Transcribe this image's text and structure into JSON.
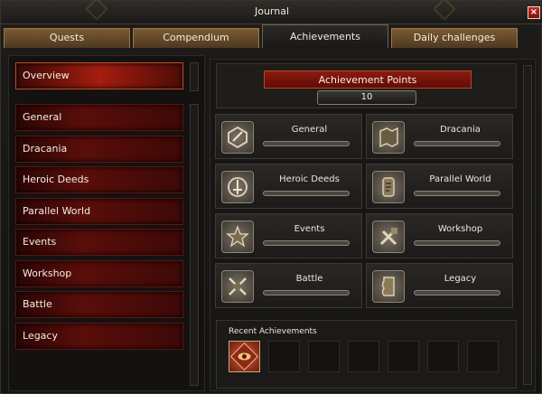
{
  "window": {
    "title": "Journal",
    "close_label": "×"
  },
  "tabs": [
    {
      "label": "Quests",
      "active": false
    },
    {
      "label": "Compendium",
      "active": false
    },
    {
      "label": "Achievements",
      "active": true
    },
    {
      "label": "Daily challenges",
      "active": false
    }
  ],
  "sidebar": {
    "overview": "Overview",
    "items": [
      {
        "label": "General"
      },
      {
        "label": "Dracania"
      },
      {
        "label": "Heroic Deeds"
      },
      {
        "label": "Parallel World"
      },
      {
        "label": "Events"
      },
      {
        "label": "Workshop"
      },
      {
        "label": "Battle"
      },
      {
        "label": "Legacy"
      }
    ]
  },
  "points": {
    "label": "Achievement Points",
    "value": "10"
  },
  "categories": [
    {
      "name": "General",
      "progress": 0,
      "icon": "trophy-icon"
    },
    {
      "name": "Dracania",
      "progress": 0,
      "icon": "map-icon"
    },
    {
      "name": "Heroic Deeds",
      "progress": 0,
      "icon": "sword-icon"
    },
    {
      "name": "Parallel World",
      "progress": 0,
      "icon": "scroll-icon"
    },
    {
      "name": "Events",
      "progress": 0,
      "icon": "star-icon"
    },
    {
      "name": "Workshop",
      "progress": 0,
      "icon": "tools-icon"
    },
    {
      "name": "Battle",
      "progress": 0,
      "icon": "crossed-swords-icon"
    },
    {
      "name": "Legacy",
      "progress": 0,
      "icon": "parchment-icon"
    }
  ],
  "recent": {
    "label": "Recent Achievements",
    "slots": [
      {
        "filled": true,
        "icon": "eye-badge-icon"
      },
      {
        "filled": false
      },
      {
        "filled": false
      },
      {
        "filled": false
      },
      {
        "filled": false
      },
      {
        "filled": false
      },
      {
        "filled": false
      }
    ]
  },
  "colors": {
    "accent_red": "#a51d0f",
    "gold": "#b89a56"
  }
}
